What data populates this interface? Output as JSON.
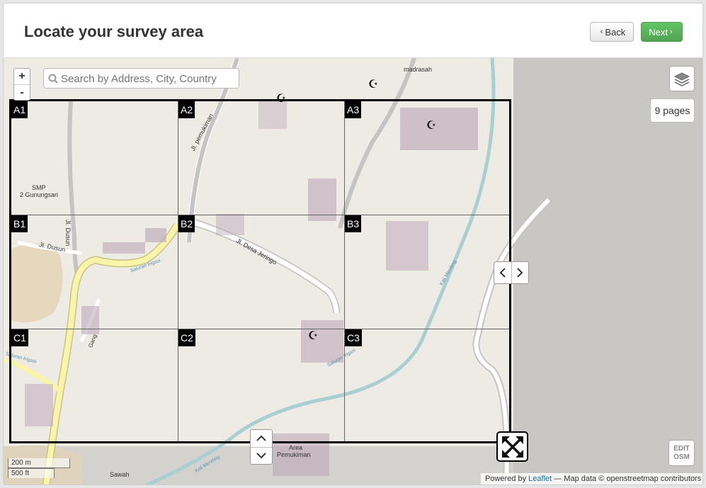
{
  "header": {
    "title": "Locate your survey area",
    "back_label": "Back",
    "next_label": "Next",
    "back_icon": "chevron-left-icon",
    "next_icon": "chevron-right-icon"
  },
  "map": {
    "search": {
      "placeholder": "Search by Address, City, Country"
    },
    "zoom": {
      "in": "+",
      "out": "-"
    },
    "pages_label": "9 pages",
    "grid": {
      "rows": [
        "A",
        "B",
        "C"
      ],
      "cols": [
        1,
        2,
        3
      ],
      "cells": [
        "A1",
        "A2",
        "A3",
        "B1",
        "B2",
        "B3",
        "C1",
        "C2",
        "C3"
      ]
    },
    "scale": {
      "metric": "200 m",
      "imperial": "500 ft"
    },
    "edit_label_1": "EDIT",
    "edit_label_2": "OSM",
    "attribution": {
      "prefix": "Powered by",
      "leaflet": "Leaflet",
      "suffix": "— Map data © openstreetmap contributors"
    },
    "place_labels": {
      "madrasah": "madrasah",
      "smp1": "SMP",
      "smp2": "2 Gunungsari",
      "jl_pemukiman": "Jl. pemukiman",
      "jl_dusun": "Jl. Dusun",
      "jl_dusun2": "Jl. Dusun",
      "jl_desa": "Jl. Desa Jeringo",
      "saluran1": "Saluran Irigasi",
      "saluran2": "Saluran Irigasi",
      "saluran3": "Saluran Irigasi",
      "gang": "Gang",
      "kali1": "Kali Meniting",
      "kali2": "Kali Meniting",
      "area1": "Area",
      "area2": "Pemukiman",
      "sawah": "Sawah"
    },
    "colors": {
      "land": "#eeebe4",
      "outside": "#c8c6c2",
      "road_major": "#f8f4a8",
      "river": "#a9cfd0",
      "buildings": "#b9a3b5"
    }
  }
}
